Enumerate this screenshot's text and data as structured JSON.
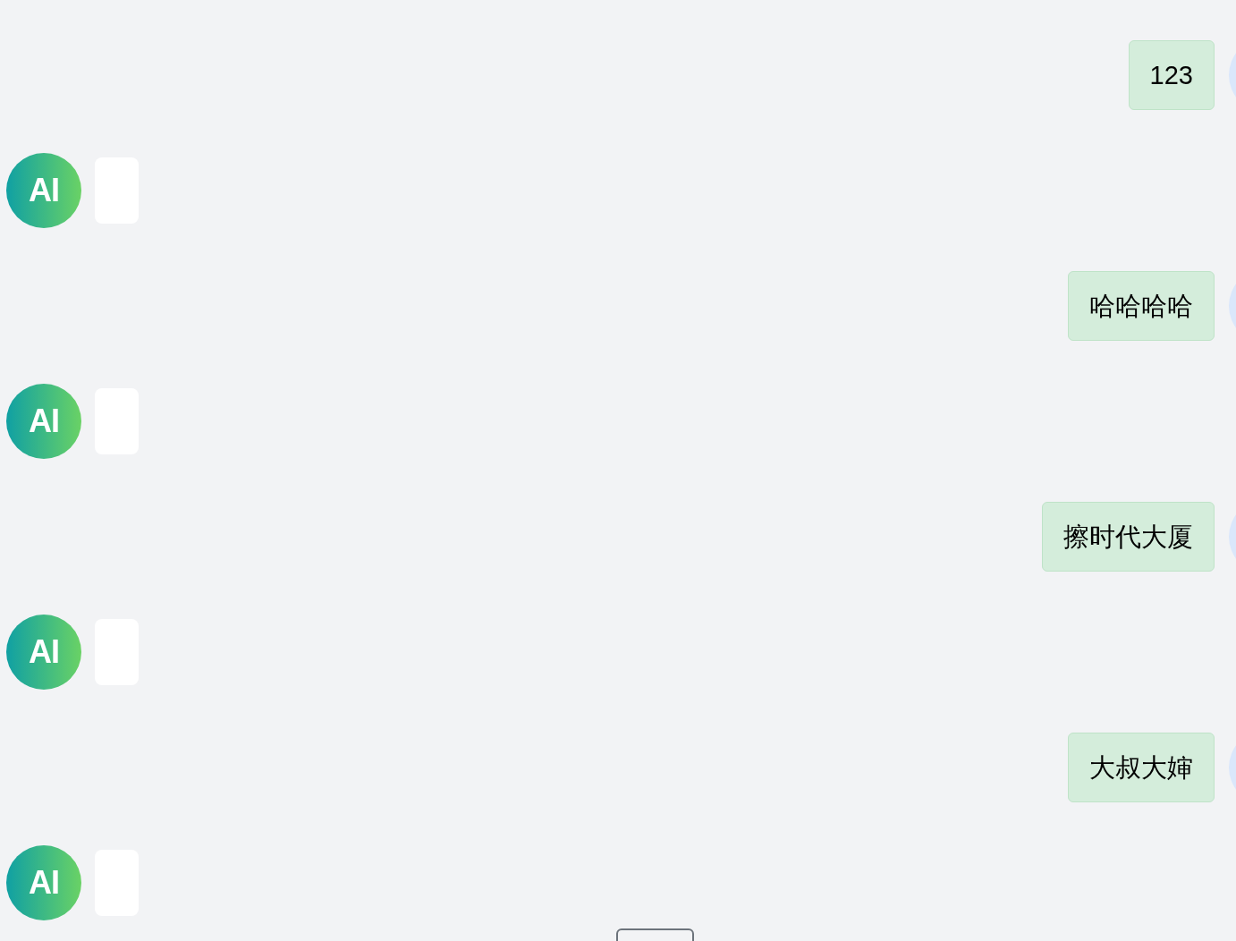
{
  "messages": [
    {
      "kind": "user",
      "text": "123"
    },
    {
      "kind": "assistant",
      "avatar": "AI"
    },
    {
      "kind": "user",
      "text": "哈哈哈哈"
    },
    {
      "kind": "assistant",
      "avatar": "AI"
    },
    {
      "kind": "user",
      "text": "擦时代大厦"
    },
    {
      "kind": "assistant",
      "avatar": "AI"
    },
    {
      "kind": "user",
      "text": "大叔大婶"
    },
    {
      "kind": "assistant",
      "avatar": "AI"
    }
  ]
}
